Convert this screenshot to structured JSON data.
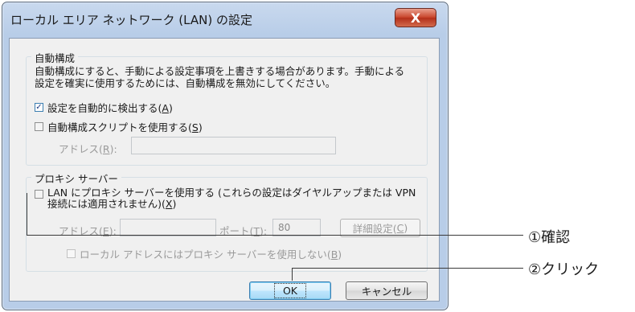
{
  "dialog": {
    "title": "ローカル エリア ネットワーク (LAN) の設定",
    "close_glyph": "X"
  },
  "auto_config": {
    "group_title": "自動構成",
    "description_line1": "自動構成にすると、手動による設定事項を上書きする場合があります。手動による",
    "description_line2": "設定を確実に使用するためには、自動構成を無効にしてください。",
    "auto_detect": {
      "label": "設定を自動的に検出する(",
      "accel": "A",
      "label_end": ")",
      "checked": true
    },
    "use_script": {
      "label": "自動構成スクリプトを使用する(",
      "accel": "S",
      "label_end": ")",
      "checked": false
    },
    "address_label": "アドレス(",
    "address_accel": "R",
    "address_label_end": "):",
    "address_value": ""
  },
  "proxy": {
    "group_title": "プロキシ サーバー",
    "use_proxy": {
      "line1": "LAN にプロキシ サーバーを使用する (これらの設定はダイヤルアップまたは VPN",
      "line2": "接続には適用されません)(",
      "accel": "X",
      "line2_end": ")",
      "checked": false
    },
    "address_label": "アドレス(",
    "address_accel": "E",
    "address_label_end": "):",
    "address_value": "",
    "port_label": "ポート(",
    "port_accel": "T",
    "port_label_end": "):",
    "port_value": "80",
    "advanced_label": "詳細設定(",
    "advanced_accel": "C",
    "advanced_label_end": ")",
    "bypass": {
      "label": "ローカル アドレスにはプロキシ サーバーを使用しない(",
      "accel": "B",
      "label_end": ")",
      "checked": false
    }
  },
  "buttons": {
    "ok": "OK",
    "cancel": "キャンセル"
  },
  "callouts": {
    "confirm": "①確認",
    "click": "②クリック"
  },
  "colors": {
    "accent": "#3c7fb1",
    "close_button": "#c9462d"
  }
}
